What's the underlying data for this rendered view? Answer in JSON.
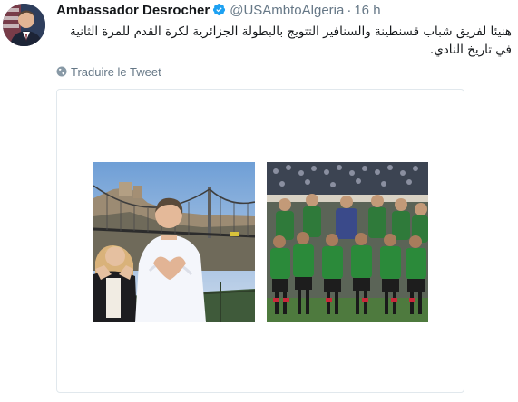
{
  "tweet": {
    "display_name": "Ambassador Desrocher",
    "handle": "@USAmbtoAlgeria",
    "separator": "·",
    "time": "16 h",
    "text": "هنيئا لفريق شباب قسنطينة والسنافير التتويج بالبطولة الجزائرية لكرة القدم للمرة الثانية في تاريخ النادي.",
    "translate_label": "Traduire le Tweet"
  },
  "icons": {
    "verified": "verified-badge-icon",
    "translate": "globe-icon"
  },
  "colors": {
    "verified_blue": "#1da1f2",
    "secondary_text": "#657786",
    "primary_text": "#14171a",
    "card_border": "#e1e8ed"
  }
}
